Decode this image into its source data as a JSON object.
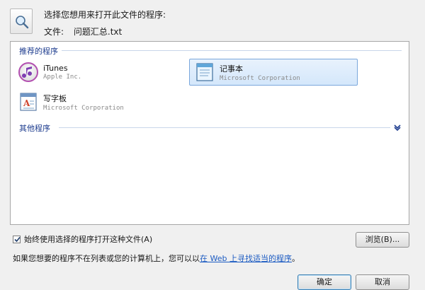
{
  "header": {
    "prompt": "选择您想用来打开此文件的程序:",
    "file_label": "文件:",
    "file_name": "问题汇总.txt",
    "icon": "search-document-icon"
  },
  "list": {
    "recommended_header": "推荐的程序",
    "other_header": "其他程序",
    "programs": [
      {
        "name": "iTunes",
        "publisher": "Apple Inc.",
        "icon": "itunes-icon",
        "selected": false
      },
      {
        "name": "记事本",
        "publisher": "Microsoft Corporation",
        "icon": "notepad-icon",
        "selected": true
      },
      {
        "name": "写字板",
        "publisher": "Microsoft Corporation",
        "icon": "wordpad-icon",
        "selected": false
      }
    ]
  },
  "options": {
    "always_use_label": "始终使用选择的程序打开这种文件(A)",
    "always_use_checked": true,
    "browse_label": "浏览(B)...",
    "web_prefix": "如果您想要的程序不在列表或您的计算机上，您可以以",
    "web_link": "在 Web 上寻找适当的程序",
    "web_suffix": "。"
  },
  "buttons": {
    "ok_label": "确定",
    "cancel_label": "取消"
  },
  "colors": {
    "selection_bg": "#d4e7fb",
    "selection_border": "#7aa7dc",
    "group_header": "#1e3d8f",
    "link": "#1c5bc2"
  }
}
